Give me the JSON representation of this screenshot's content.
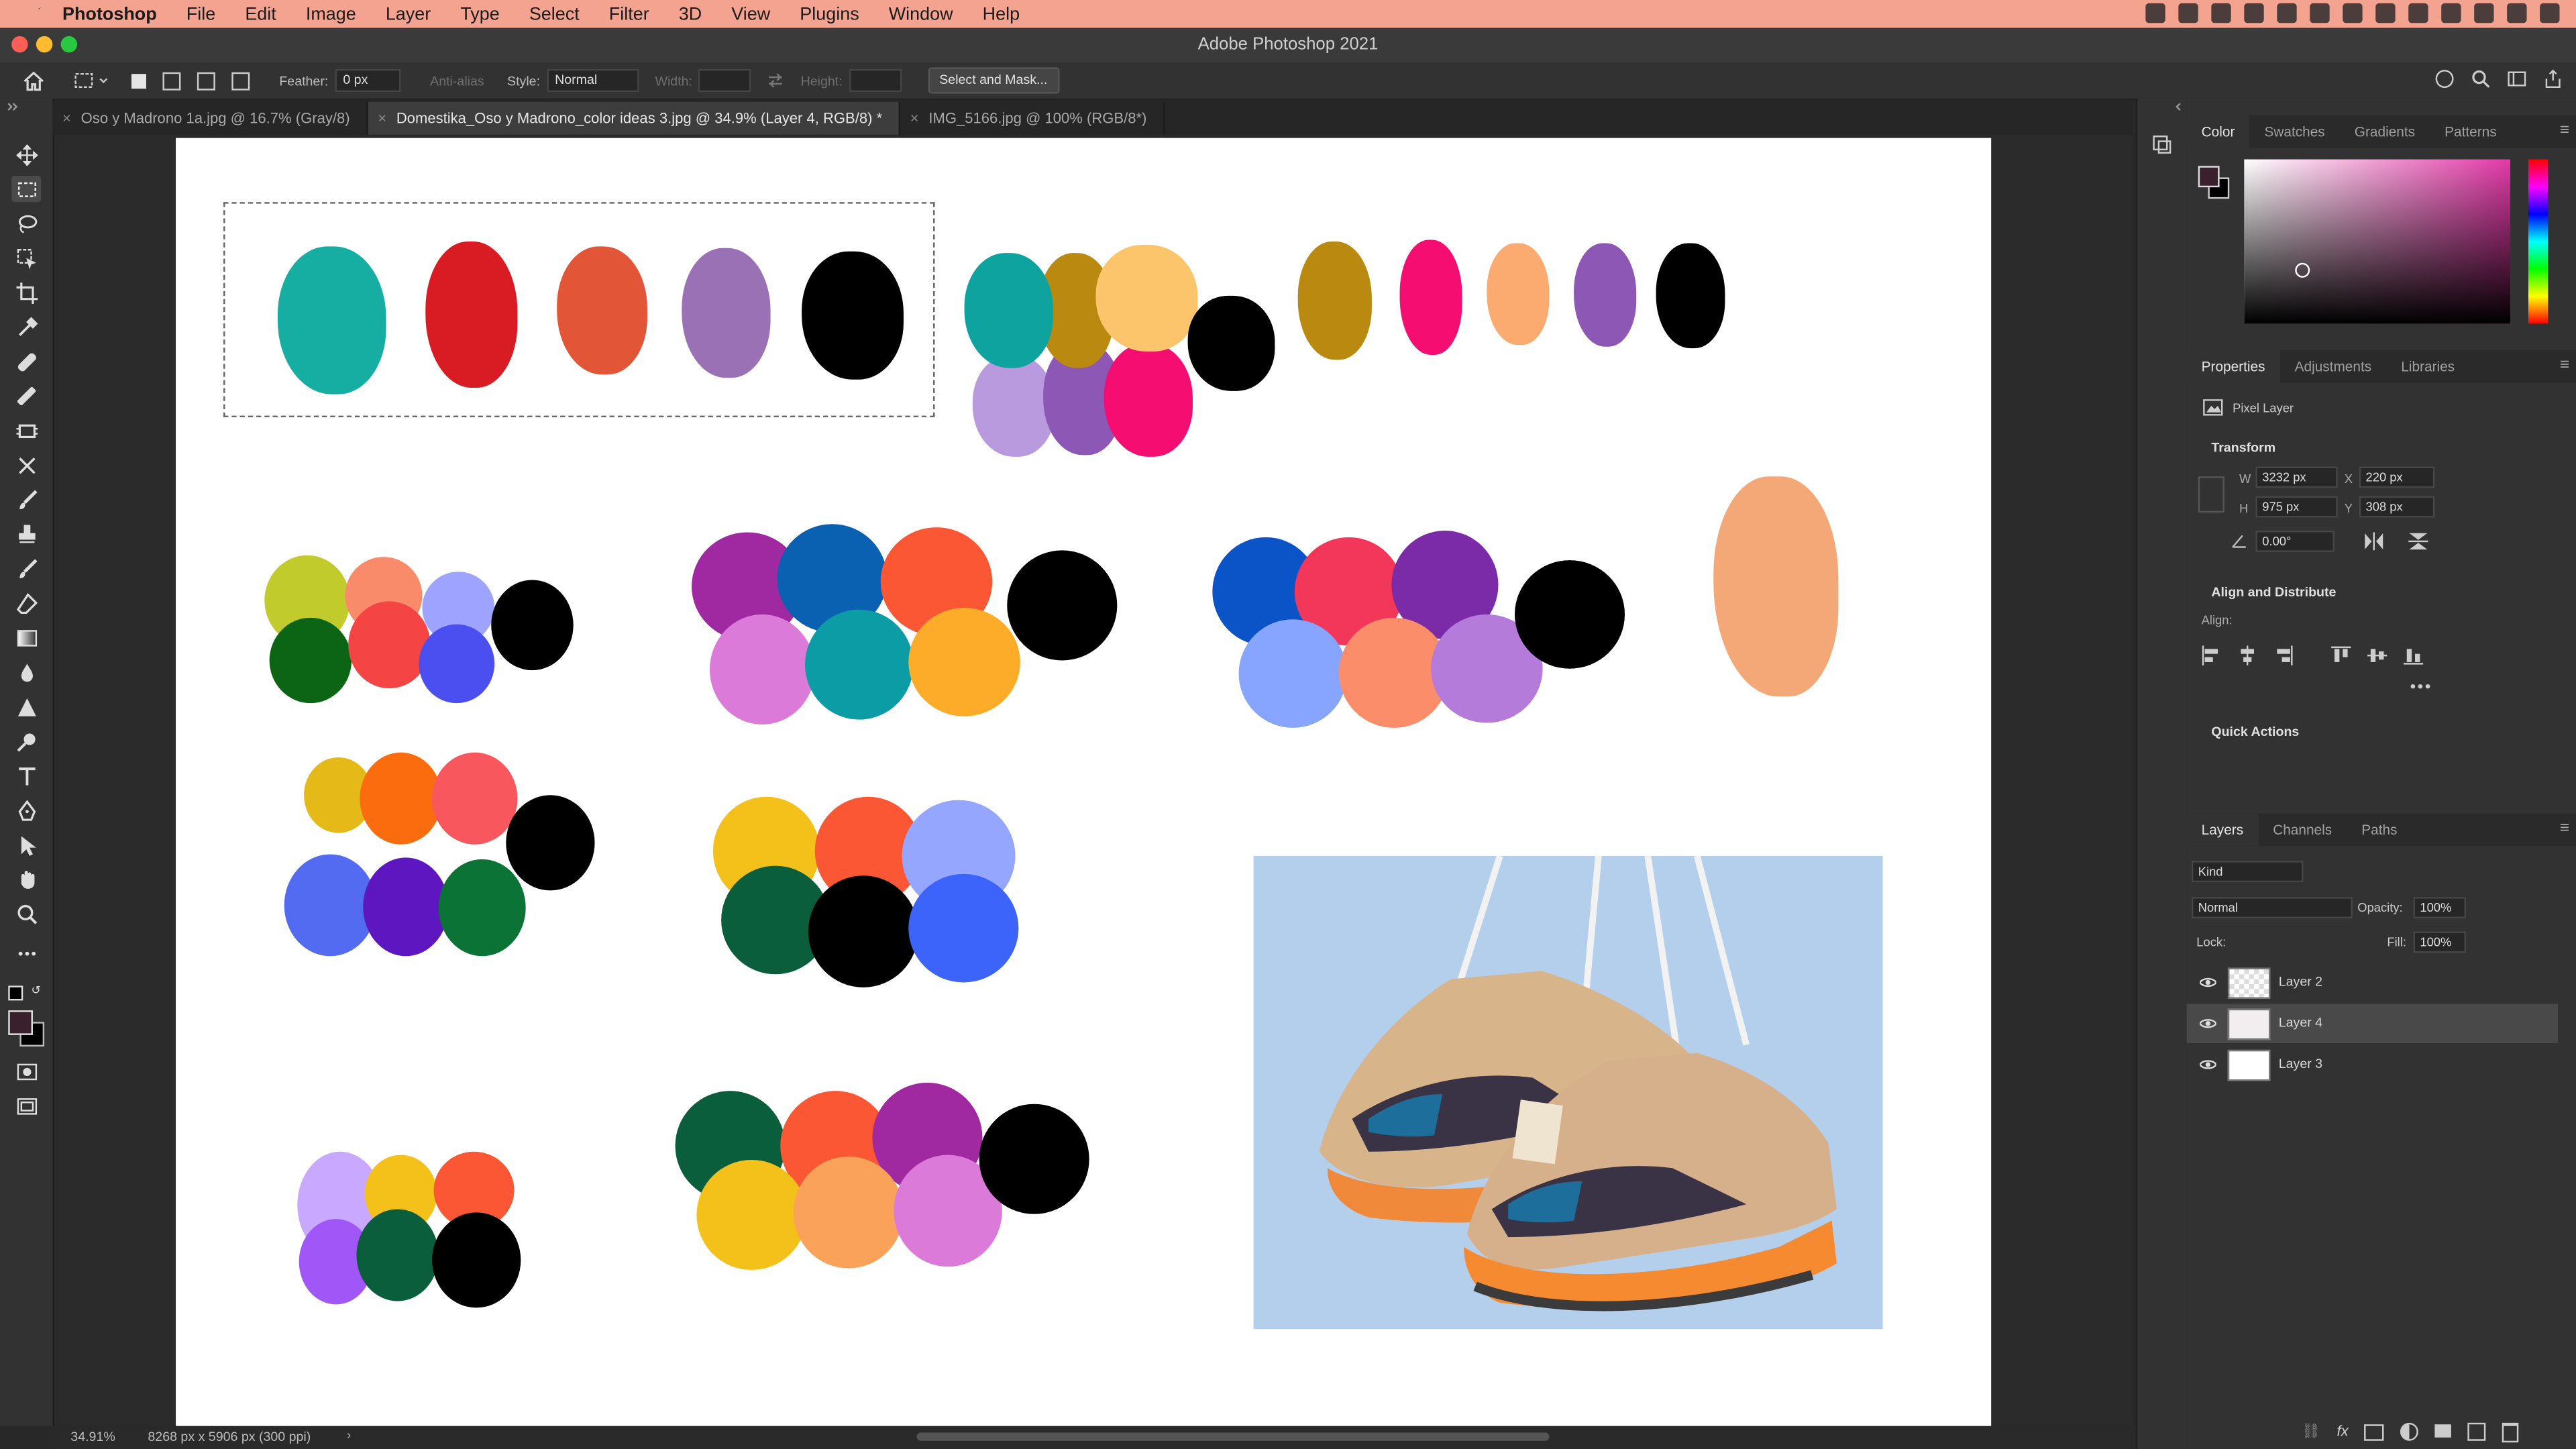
{
  "menubar": {
    "items": [
      "Photoshop",
      "File",
      "Edit",
      "Image",
      "Layer",
      "Type",
      "Select",
      "Filter",
      "3D",
      "View",
      "Plugins",
      "Window",
      "Help"
    ]
  },
  "titlebar": {
    "title": "Adobe Photoshop 2021"
  },
  "options": {
    "feather_label": "Feather:",
    "feather_value": "0 px",
    "antialias_label": "Anti-alias",
    "style_label": "Style:",
    "style_value": "Normal",
    "width_label": "Width:",
    "height_label": "Height:",
    "select_mask": "Select and Mask..."
  },
  "tabs": [
    {
      "label": "Oso y Madrono 1a.jpg @ 16.7% (Gray/8)"
    },
    {
      "label": "Domestika_Oso y Madrono_color ideas 3.jpg @ 34.9% (Layer 4, RGB/8) *"
    },
    {
      "label": "IMG_5166.jpg @ 100% (RGB/8*)"
    }
  ],
  "panels": {
    "color_tabs": [
      "Color",
      "Swatches",
      "Gradients",
      "Patterns"
    ],
    "prop_tabs": [
      "Properties",
      "Adjustments",
      "Libraries"
    ],
    "pixel_layer": "Pixel Layer",
    "transform": "Transform",
    "w_label": "W",
    "w_value": "3232 px",
    "x_label": "X",
    "x_value": "220 px",
    "h_label": "H",
    "h_value": "975 px",
    "y_label": "Y",
    "y_value": "308 px",
    "angle_value": "0.00°",
    "align_distribute": "Align and Distribute",
    "align_label": "Align:",
    "quick_actions": "Quick Actions",
    "layer_tabs": [
      "Layers",
      "Channels",
      "Paths"
    ],
    "kind": "Kind",
    "blend_mode": "Normal",
    "opacity_label": "Opacity:",
    "opacity_value": "100%",
    "lock_label": "Lock:",
    "fill_label": "Fill:",
    "fill_value": "100%",
    "layers": [
      "Layer 2",
      "Layer 4",
      "Layer 3"
    ]
  },
  "status": {
    "zoom": "34.91%",
    "doc_info": "8268 px x 5906 px (300 ppi)"
  },
  "colors": {
    "teal": "#16ada3",
    "red": "#d91b24",
    "orange": "#e25536",
    "lavender": "#9a71b4",
    "black": "#000000"
  }
}
